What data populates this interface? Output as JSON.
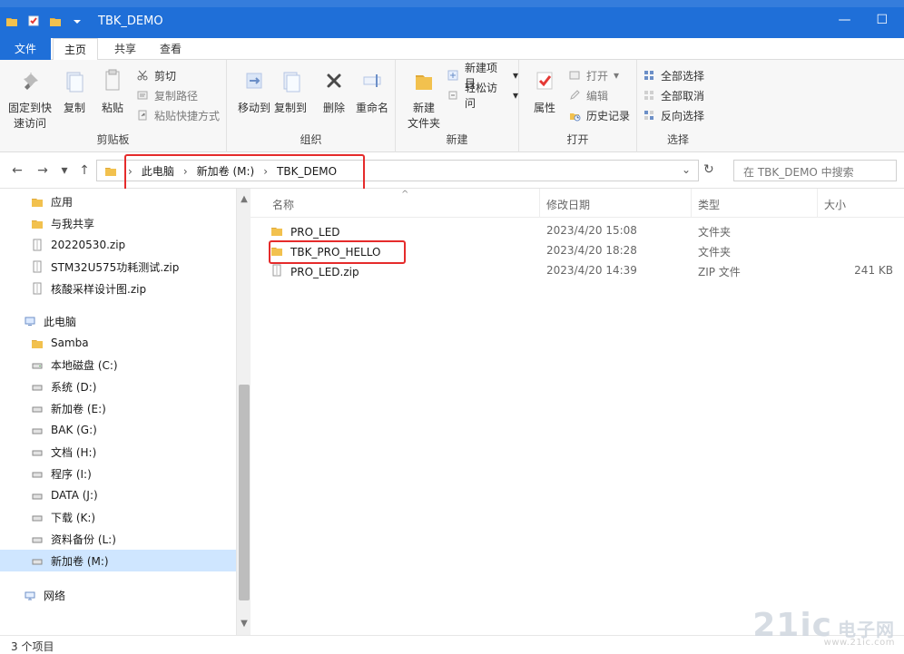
{
  "window": {
    "title": "TBK_DEMO",
    "minimize": "—",
    "maximize": "☐"
  },
  "ribbon": {
    "tabs": [
      "文件",
      "主页",
      "共享",
      "查看"
    ],
    "groups": {
      "clipboard": {
        "name": "剪贴板",
        "pin_label_line1": "固定到快",
        "pin_label_line2": "速访问",
        "copy": "复制",
        "paste": "粘贴",
        "cut": "剪切",
        "copy_path": "复制路径",
        "paste_shortcut": "粘贴快捷方式"
      },
      "organize": {
        "name": "组织",
        "move_to": "移动到",
        "copy_to": "复制到",
        "delete": "删除",
        "rename": "重命名"
      },
      "new": {
        "name": "新建",
        "new_folder_line1": "新建",
        "new_folder_line2": "文件夹",
        "new_item": "新建项目",
        "easy_access": "轻松访问"
      },
      "open": {
        "name": "打开",
        "properties": "属性",
        "open": "打开",
        "edit": "编辑",
        "history": "历史记录"
      },
      "select": {
        "name": "选择",
        "select_all": "全部选择",
        "select_none": "全部取消",
        "invert": "反向选择"
      }
    }
  },
  "address": {
    "crumbs": [
      "此电脑",
      "新加卷 (M:)",
      "TBK_DEMO"
    ],
    "search_placeholder": "在 TBK_DEMO 中搜索"
  },
  "sidebar": {
    "quick": [
      {
        "label": "应用",
        "icon": "folder-icon"
      },
      {
        "label": "与我共享",
        "icon": "folder-icon"
      },
      {
        "label": "20220530.zip",
        "icon": "zip-icon"
      },
      {
        "label": "STM32U575功耗测试.zip",
        "icon": "zip-icon"
      },
      {
        "label": "核酸采样设计图.zip",
        "icon": "zip-icon"
      }
    ],
    "this_pc": {
      "label": "此电脑",
      "icon": "computer-icon"
    },
    "drives": [
      {
        "label": "Samba",
        "icon": "folder-icon"
      },
      {
        "label": "本地磁盘 (C:)",
        "icon": "drive-icon"
      },
      {
        "label": "系统 (D:)",
        "icon": "drive-icon"
      },
      {
        "label": "新加卷 (E:)",
        "icon": "drive-icon"
      },
      {
        "label": "BAK (G:)",
        "icon": "drive-icon"
      },
      {
        "label": "文档 (H:)",
        "icon": "drive-icon"
      },
      {
        "label": "程序 (I:)",
        "icon": "drive-icon"
      },
      {
        "label": "DATA (J:)",
        "icon": "drive-icon"
      },
      {
        "label": "下载 (K:)",
        "icon": "drive-icon"
      },
      {
        "label": "资料备份 (L:)",
        "icon": "drive-icon"
      },
      {
        "label": "新加卷 (M:)",
        "icon": "drive-icon",
        "selected": true
      }
    ],
    "network": {
      "label": "网络",
      "icon": "network-icon"
    }
  },
  "filelist": {
    "columns": {
      "name": "名称",
      "date": "修改日期",
      "type": "类型",
      "size": "大小"
    },
    "rows": [
      {
        "name": "PRO_LED",
        "date": "2023/4/20 15:08",
        "type": "文件夹",
        "size": ""
      },
      {
        "name": "TBK_PRO_HELLO",
        "date": "2023/4/20 18:28",
        "type": "文件夹",
        "size": ""
      },
      {
        "name": "PRO_LED.zip",
        "date": "2023/4/20 14:39",
        "type": "ZIP 文件",
        "size": "241 KB"
      }
    ]
  },
  "status": {
    "items_count": "3 个项目"
  },
  "watermark": {
    "brand": "21ic",
    "cn": "电子网",
    "url": "www.21ic.com"
  },
  "colors": {
    "accent": "#1f6fd8",
    "selection": "#cfe6ff",
    "highlight_box": "#e52b2b"
  }
}
